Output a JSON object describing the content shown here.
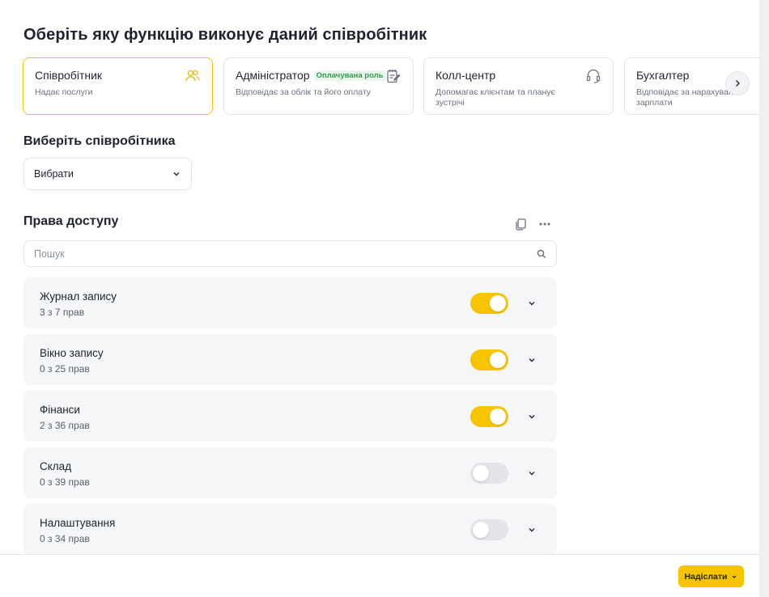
{
  "page_title": "Оберіть яку функцію виконує даний співробітник",
  "roles": [
    {
      "title": "Співробітник",
      "badge": "",
      "desc": "Надає послуги",
      "icon": "users-icon",
      "selected": true
    },
    {
      "title": "Адміністратор",
      "badge": "Оплачувана роль",
      "desc": "Відповідає за облік та його оплату",
      "icon": "notebook-edit-icon",
      "selected": false
    },
    {
      "title": "Колл-центр",
      "badge": "",
      "desc": "Допомагає клієнтам та планує зустрічі",
      "icon": "headset-icon",
      "selected": false
    },
    {
      "title": "Бухгалтер",
      "badge": "",
      "desc": "Відповідає за нарахування зарплати",
      "icon": "",
      "selected": false
    }
  ],
  "employee_section": {
    "title": "Виберіть співробітника",
    "select_value": "Вибрати"
  },
  "access_section": {
    "title": "Права доступу",
    "search_placeholder": "Пошук"
  },
  "permissions": [
    {
      "name": "Журнал запису",
      "count": "3 з 7 прав",
      "enabled": true
    },
    {
      "name": "Вікно запису",
      "count": "0 з 25 прав",
      "enabled": true
    },
    {
      "name": "Фінанси",
      "count": "2 з 36 прав",
      "enabled": true
    },
    {
      "name": "Склад",
      "count": "0 з 39 прав",
      "enabled": false
    },
    {
      "name": "Налаштування",
      "count": "0 з 34 прав",
      "enabled": false
    }
  ],
  "footer": {
    "submit_label": "Надіслати"
  },
  "colors": {
    "accent": "#f6c500",
    "badge_green": "#2e9e4f",
    "row_bg": "#f5f6f8"
  }
}
